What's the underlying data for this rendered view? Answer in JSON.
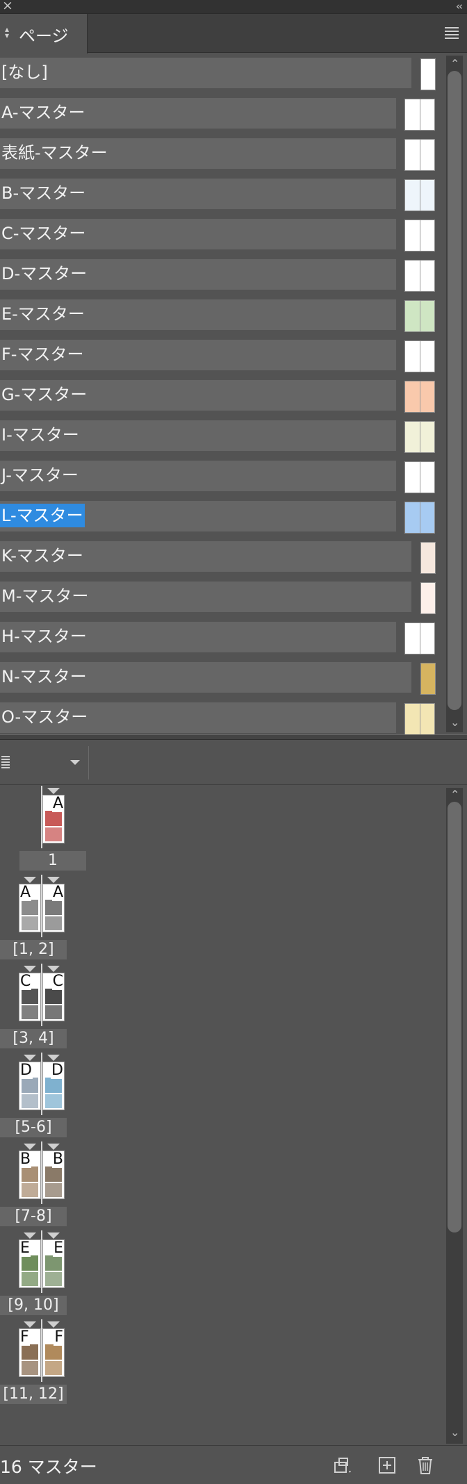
{
  "panel": {
    "tab_label": "ページ",
    "status": "16 マスター"
  },
  "masters": [
    {
      "name": "[なし]",
      "thumb": "single",
      "color": "#ffffff"
    },
    {
      "name": "A-マスター",
      "thumb": "spread",
      "color": "#ffffff"
    },
    {
      "name": "表紙-マスター",
      "thumb": "spread",
      "color": "#ffffff"
    },
    {
      "name": "B-マスター",
      "thumb": "spread",
      "color": "#eef5fb"
    },
    {
      "name": "C-マスター",
      "thumb": "spread",
      "color": "#ffffff"
    },
    {
      "name": "D-マスター",
      "thumb": "spread",
      "color": "#ffffff"
    },
    {
      "name": "E-マスター",
      "thumb": "spread",
      "color": "#cfe6c3"
    },
    {
      "name": "F-マスター",
      "thumb": "spread",
      "color": "#ffffff"
    },
    {
      "name": "G-マスター",
      "thumb": "spread",
      "color": "#f9c9ac"
    },
    {
      "name": "I-マスター",
      "thumb": "spread",
      "color": "#f1f1d9"
    },
    {
      "name": "J-マスター",
      "thumb": "spread",
      "color": "#ffffff"
    },
    {
      "name": "L-マスター",
      "thumb": "spread",
      "color": "#a7cbf2",
      "selected": true
    },
    {
      "name": "K-マスター",
      "thumb": "single",
      "color": "#f6e8de"
    },
    {
      "name": "M-マスター",
      "thumb": "single",
      "color": "#fdf0ea"
    },
    {
      "name": "H-マスター",
      "thumb": "spread",
      "color": "#ffffff"
    },
    {
      "name": "N-マスター",
      "thumb": "single",
      "color": "#d6b460"
    },
    {
      "name": "O-マスター",
      "thumb": "spread",
      "color": "#f3e6b4"
    }
  ],
  "pages": [
    {
      "label": "1",
      "left": null,
      "right": "A",
      "rightColor": "#c85a58"
    },
    {
      "label": "[1, 2]",
      "left": "A",
      "right": "A",
      "leftColor": "#8c8c8c",
      "rightColor": "#7a7a7a"
    },
    {
      "label": "[3, 4]",
      "left": "C",
      "right": "C",
      "leftColor": "#555555",
      "rightColor": "#4a4a4a"
    },
    {
      "label": "[5-6]",
      "left": "D",
      "right": "D",
      "leftColor": "#9aa9b8",
      "rightColor": "#7fb1cf"
    },
    {
      "label": "[7-8]",
      "left": "B",
      "right": "B",
      "leftColor": "#a98f74",
      "rightColor": "#8a7a68"
    },
    {
      "label": "[9, 10]",
      "left": "E",
      "right": "E",
      "leftColor": "#6f8e5c",
      "rightColor": "#7d9670"
    },
    {
      "label": "[11, 12]",
      "left": "F",
      "right": "F",
      "leftColor": "#8a6f55",
      "rightColor": "#b08a5c"
    }
  ],
  "icons": {
    "close": "×",
    "collapse": "‹‹",
    "tab_arrows": "◇",
    "scroll_up": "⌃",
    "scroll_down": "⌄"
  }
}
